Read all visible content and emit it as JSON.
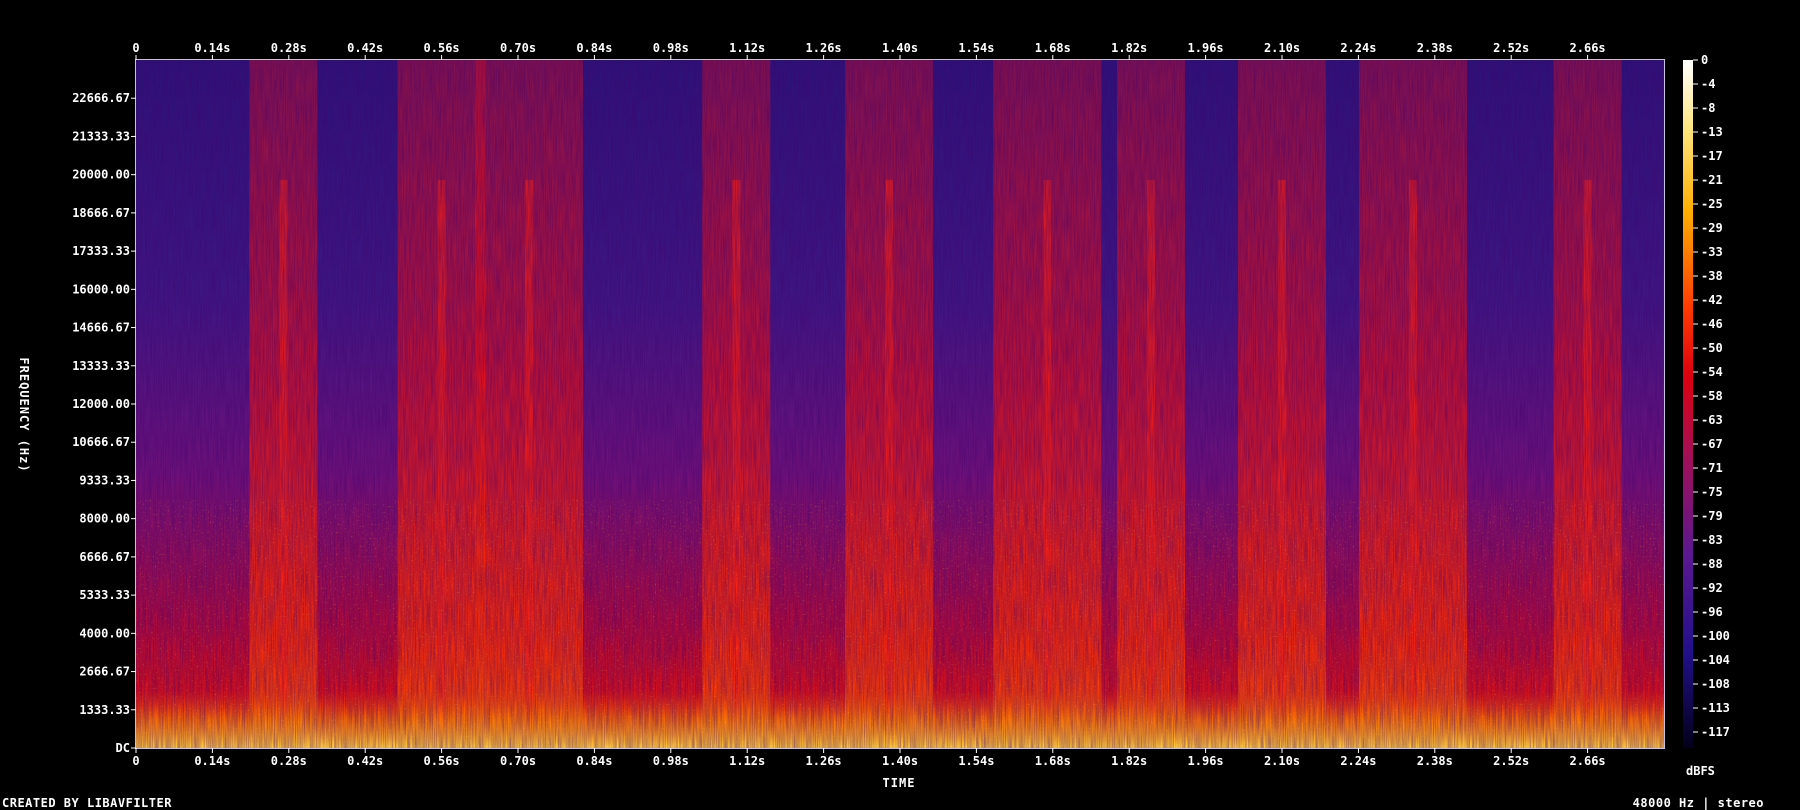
{
  "chart_data": {
    "type": "heatmap",
    "title": "",
    "xlabel": "TIME",
    "ylabel": "FREQUENCY (Hz)",
    "x_ticks": [
      "0",
      "0.14s",
      "0.28s",
      "0.42s",
      "0.56s",
      "0.70s",
      "0.84s",
      "0.98s",
      "1.12s",
      "1.26s",
      "1.40s",
      "1.54s",
      "1.68s",
      "1.82s",
      "1.96s",
      "2.10s",
      "2.24s",
      "2.38s",
      "2.52s",
      "2.66s"
    ],
    "x_tick_values": [
      0,
      0.14,
      0.28,
      0.42,
      0.56,
      0.7,
      0.84,
      0.98,
      1.12,
      1.26,
      1.4,
      1.54,
      1.68,
      1.82,
      1.96,
      2.1,
      2.24,
      2.38,
      2.52,
      2.66
    ],
    "xlim": [
      0,
      2.8
    ],
    "y_ticks": [
      "DC",
      "1333.33",
      "2666.67",
      "4000.00",
      "5333.33",
      "6666.67",
      "8000.00",
      "9333.33",
      "10666.67",
      "12000.00",
      "13333.33",
      "14666.67",
      "16000.00",
      "17333.33",
      "18666.67",
      "20000.00",
      "21333.33",
      "22666.67"
    ],
    "y_tick_values": [
      0,
      1333.33,
      2666.67,
      4000,
      5333.33,
      6666.67,
      8000,
      9333.33,
      10666.67,
      12000,
      13333.33,
      14666.67,
      16000,
      17333.33,
      18666.67,
      20000,
      21333.33,
      22666.67
    ],
    "ylim": [
      0,
      24000
    ],
    "colorbar": {
      "unit": "dBFS",
      "ticks": [
        "0",
        "-4",
        "-8",
        "-13",
        "-17",
        "-21",
        "-25",
        "-29",
        "-33",
        "-38",
        "-42",
        "-46",
        "-50",
        "-54",
        "-58",
        "-63",
        "-67",
        "-71",
        "-75",
        "-79",
        "-83",
        "-88",
        "-92",
        "-96",
        "-100",
        "-104",
        "-108",
        "-113",
        "-117"
      ],
      "range": [
        -120,
        0
      ],
      "colormap": "intensity"
    },
    "bright_time_bands": [
      0.27,
      0.56,
      0.72,
      1.1,
      1.38,
      1.67,
      1.86,
      2.1,
      2.34,
      2.66
    ],
    "grid": false
  },
  "footer": {
    "left": "CREATED BY LIBAVFILTER",
    "right": "48000 Hz | stereo"
  },
  "colors": {
    "background": "#000000",
    "text": "#ffffff",
    "plot_border": "#c8c0e0"
  }
}
